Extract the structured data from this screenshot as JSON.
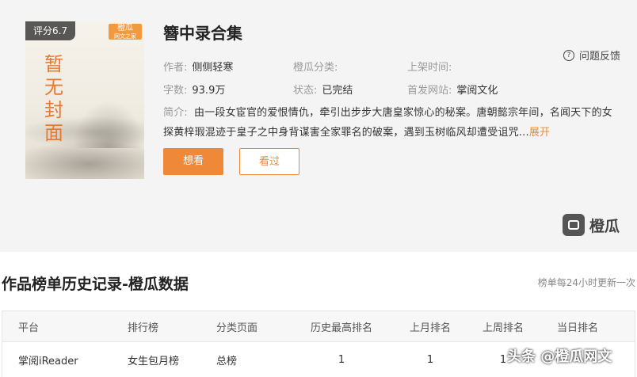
{
  "book": {
    "cover_text": "暂无封面",
    "rating": "评分6.7",
    "cover_logo_line1": "橙瓜",
    "cover_logo_line2": "网文之家",
    "title": "簪中录合集",
    "feedback": "问题反馈",
    "author_label": "作者:",
    "author": "侧侧轻寒",
    "category_label": "橙瓜分类:",
    "category": "",
    "release_label": "上架时间:",
    "release": "",
    "words_label": "字数:",
    "words": "93.9万",
    "status_label": "状态:",
    "status": "已完结",
    "site_label": "首发网站:",
    "site": "掌阅文化",
    "intro_label": "简介:",
    "intro": "由一段女宦官的爱恨情仇，牵引出步步大唐皇家惊心的秘案。唐朝懿宗年间，名闻天下的女探黄梓瑕混迹于皇子之中身背谋害全家罪名的破案，遇到玉树临风却遭受诅咒...",
    "intro_more": "展开",
    "want_button": "想看",
    "seen_button": "看过",
    "brand": "橙瓜"
  },
  "ranking": {
    "title": "作品榜单历史记录-橙瓜数据",
    "note": "榜单每24小时更新一次",
    "columns": [
      "平台",
      "排行榜",
      "分类页面",
      "历史最高排名",
      "上月排名",
      "上周排名",
      "当日排名"
    ],
    "rows": [
      [
        "掌阅iReader",
        "女生包月榜",
        "总榜",
        "1",
        "1",
        "1",
        ""
      ]
    ]
  },
  "watermark": "头条 @橙瓜网文"
}
